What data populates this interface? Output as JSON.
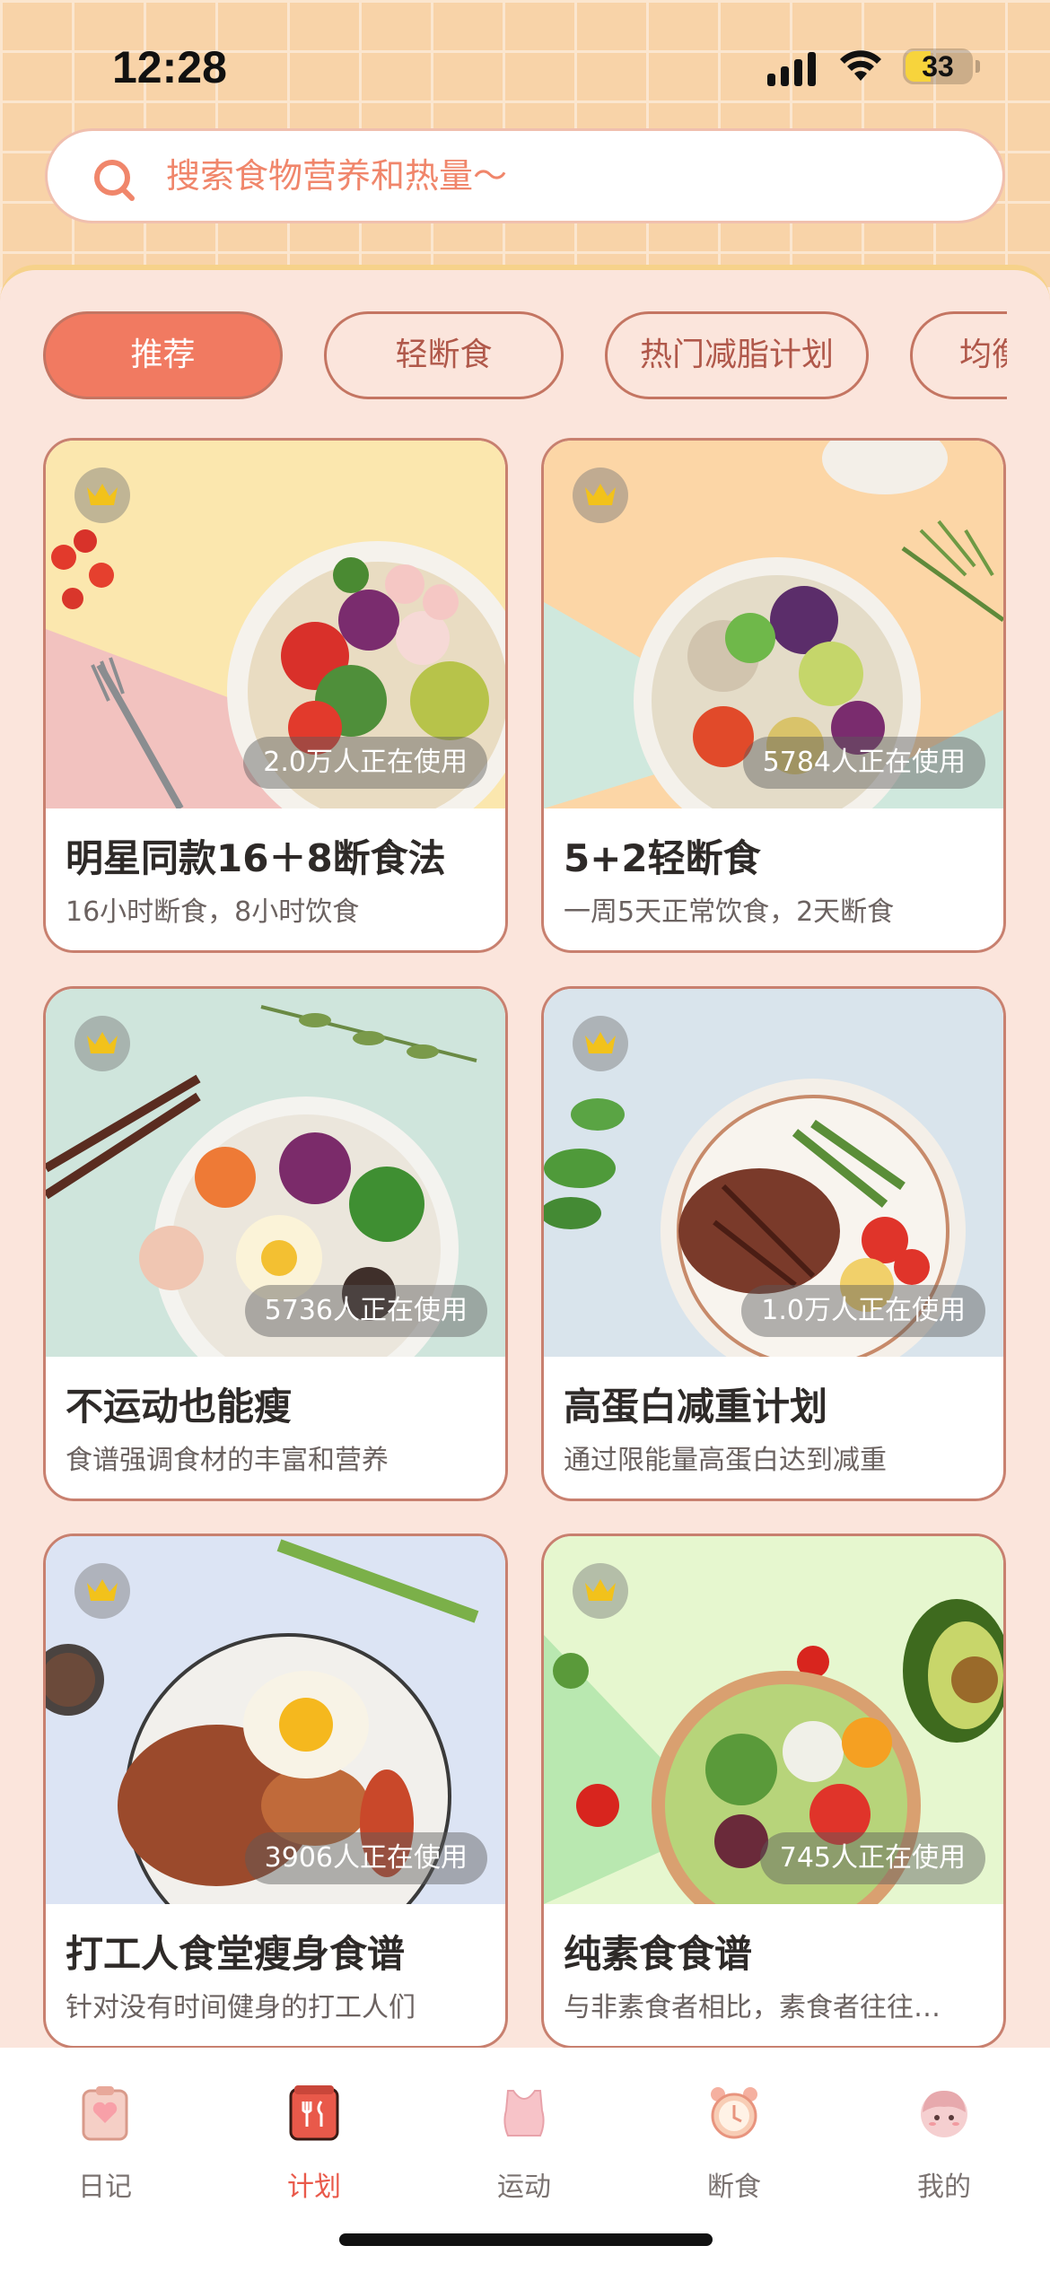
{
  "status_bar": {
    "time": "12:28",
    "battery": "33"
  },
  "search": {
    "placeholder": "搜索食物营养和热量～"
  },
  "tabs": [
    {
      "label": "推荐",
      "active": true
    },
    {
      "label": "轻断食",
      "active": false
    },
    {
      "label": "热门减脂计划",
      "active": false
    },
    {
      "label": "均衡",
      "active": false
    }
  ],
  "plans": [
    {
      "title": "明星同款16＋8断食法",
      "subtitle": "16小时断食，8小时饮食",
      "users": "2.0万人正在使用"
    },
    {
      "title": "5+2轻断食",
      "subtitle": "一周5天正常饮食，2天断食",
      "users": "5784人正在使用"
    },
    {
      "title": "不运动也能瘦",
      "subtitle": "食谱强调食材的丰富和营养",
      "users": "5736人正在使用"
    },
    {
      "title": "高蛋白减重计划",
      "subtitle": "通过限能量高蛋白达到减重",
      "users": "1.0万人正在使用"
    },
    {
      "title": "打工人食堂瘦身食谱",
      "subtitle": "针对没有时间健身的打工人们",
      "users": "3906人正在使用"
    },
    {
      "title": "纯素食食谱",
      "subtitle": "与非素食者相比，素食者往往…",
      "users": "745人正在使用"
    }
  ],
  "bottom_nav": [
    {
      "label": "日记",
      "icon": "clipboard-heart-icon",
      "active": false
    },
    {
      "label": "计划",
      "icon": "plan-utensils-icon",
      "active": true
    },
    {
      "label": "运动",
      "icon": "sports-top-icon",
      "active": false
    },
    {
      "label": "断食",
      "icon": "alarm-clock-icon",
      "active": false
    },
    {
      "label": "我的",
      "icon": "avatar-icon",
      "active": false
    }
  ],
  "colors": {
    "accent": "#f17a61",
    "tab_border": "#c47562",
    "panel_bg": "#fbe5dc",
    "header_brick": "#f8d3a8",
    "active_nav": "#e9594a"
  }
}
